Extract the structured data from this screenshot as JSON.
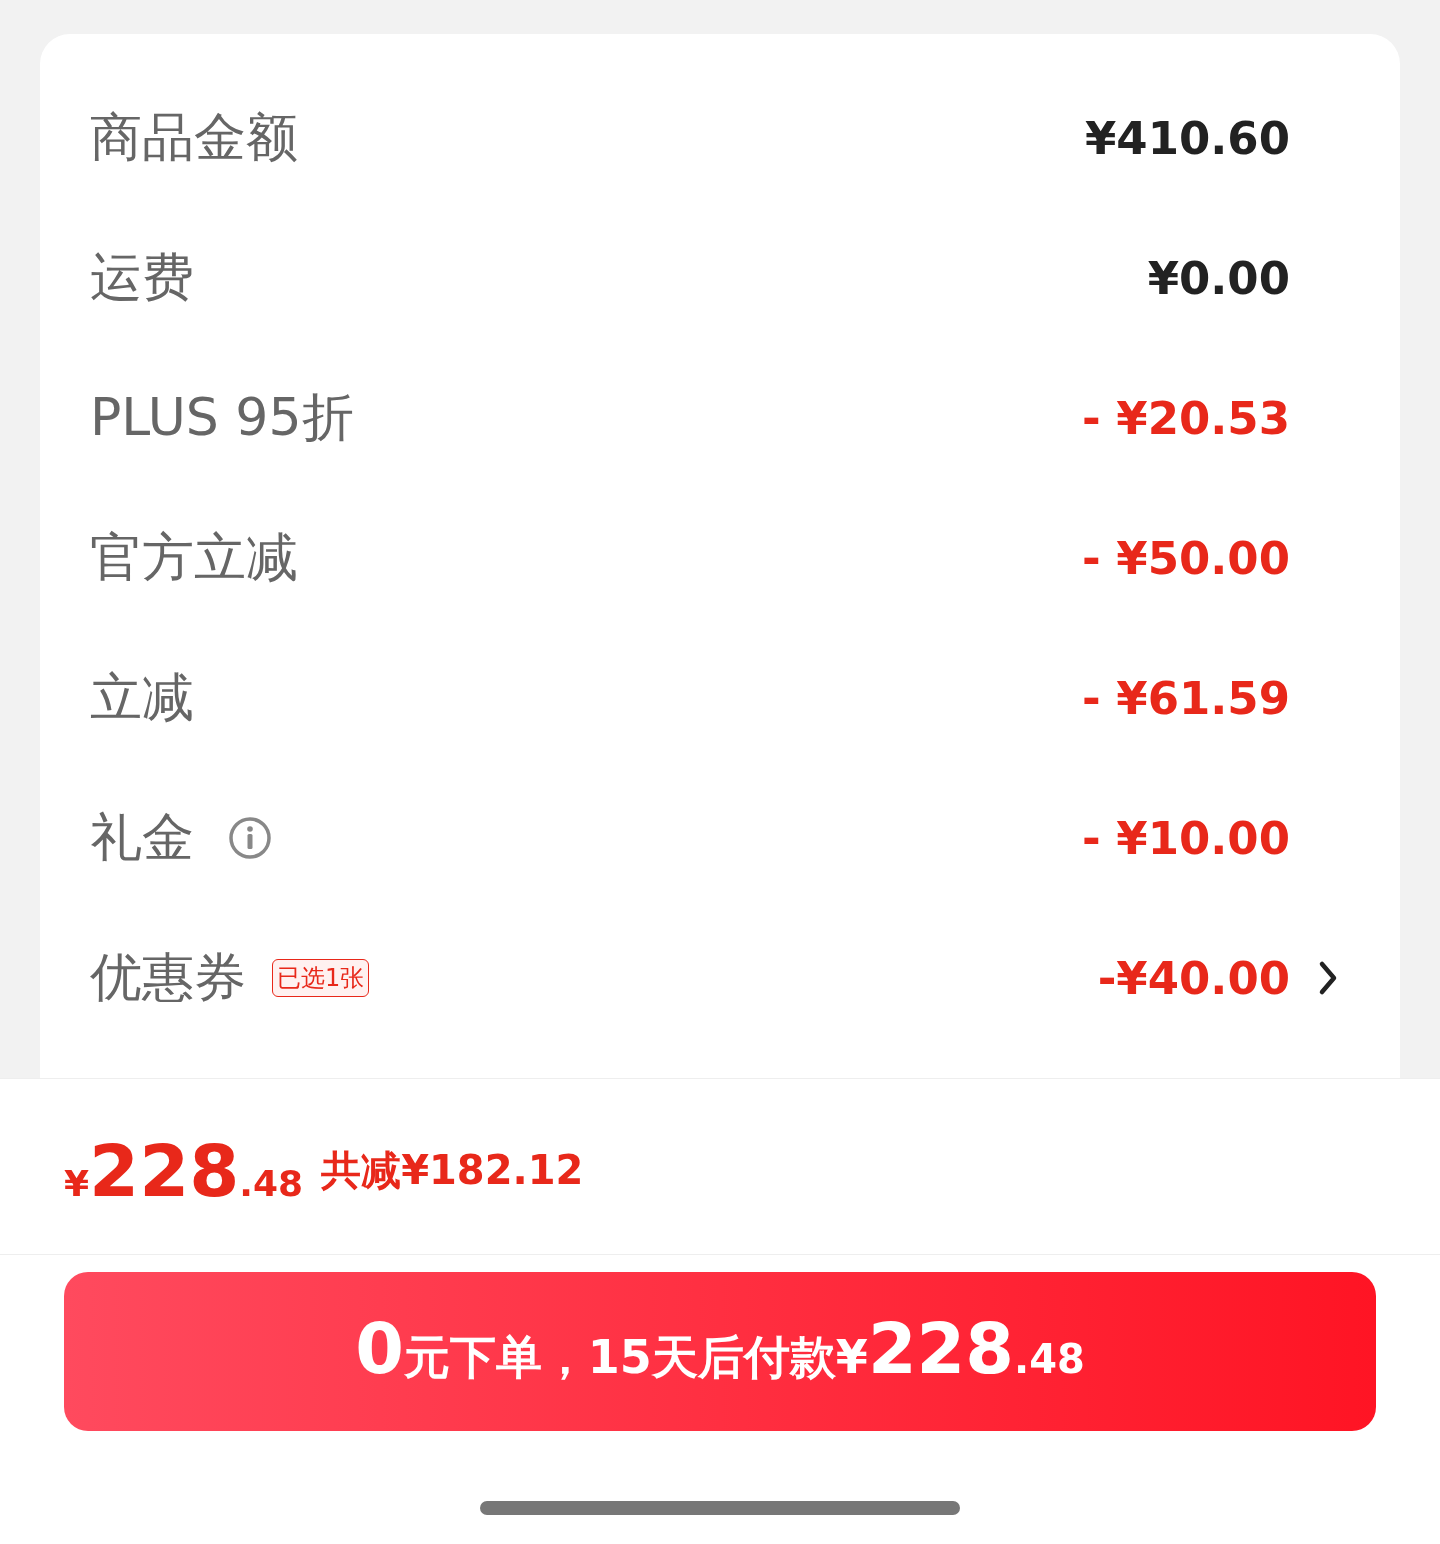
{
  "rows": [
    {
      "label": "商品金额",
      "value": "¥410.60",
      "kind": "charge"
    },
    {
      "label": "运费",
      "value": "¥0.00",
      "kind": "charge"
    },
    {
      "label": "PLUS 95折",
      "value": "- ¥20.53",
      "kind": "discount"
    },
    {
      "label": "官方立减",
      "value": "- ¥50.00",
      "kind": "discount"
    },
    {
      "label": "立减",
      "value": "- ¥61.59",
      "kind": "discount"
    },
    {
      "label": "礼金",
      "value": "- ¥10.00",
      "kind": "discount",
      "info": true
    },
    {
      "label": "优惠券",
      "badge": "已选1张",
      "value": "-¥40.00",
      "kind": "discount",
      "chevron": true
    }
  ],
  "total": {
    "currency": "¥",
    "integer": "228",
    "decimal": ".48",
    "savings": "共减¥182.12"
  },
  "pay_button": {
    "lead": "0",
    "middle": "元下单，15天后付款¥",
    "integer": "228",
    "decimal": ".48"
  }
}
